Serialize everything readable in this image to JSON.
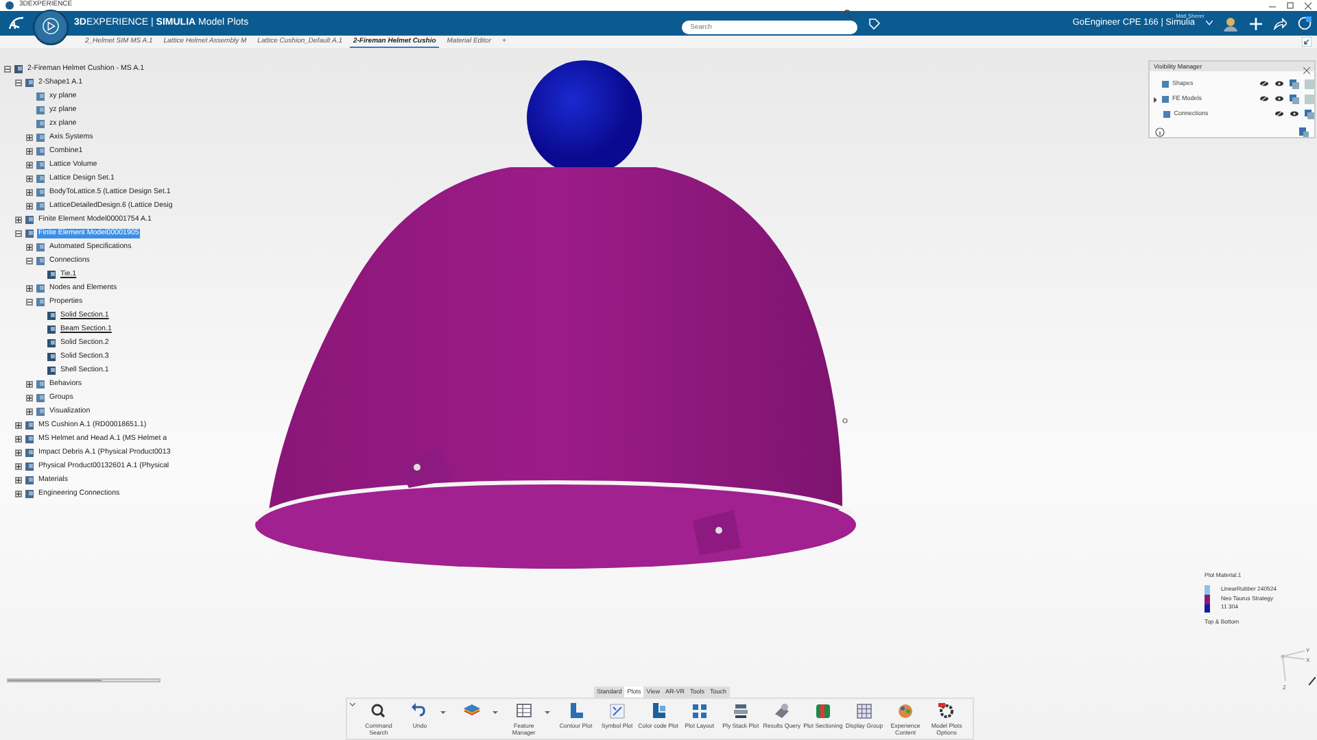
{
  "app_window": {
    "title": "3DEXPERIENCE"
  },
  "header": {
    "title": "**3D**EXPERIENCE | **SIMULIA** Model Plots",
    "search": {
      "placeholder": "Search"
    },
    "user": "Matt Sherer",
    "tenant": "GoEngineer CPE 166 | Simulia"
  },
  "tabs": [
    {
      "label": "2_Helmet SIM MS A.1",
      "selected": false
    },
    {
      "label": "Lattice Helmet Assembly M",
      "selected": false
    },
    {
      "label": "Lattice Cushion_Default A.1",
      "selected": false
    },
    {
      "label": "2-Fireman Helmet Cushio",
      "selected": true
    },
    {
      "label": "Material Editor",
      "selected": false
    },
    {
      "label": "+",
      "selected": false
    }
  ],
  "tree": [
    {
      "label": "2-Fireman Helmet Cushion - MS A.1",
      "expanded": true,
      "selected": false,
      "children": [
        {
          "label": "2-Shape1 A.1",
          "expanded": true,
          "selected": false,
          "children": [
            {
              "label": "xy plane",
              "selected": false
            },
            {
              "label": "yz plane",
              "selected": false
            },
            {
              "label": "zx plane",
              "selected": false
            },
            {
              "label": "Axis Systems",
              "expanded": false,
              "selected": false
            },
            {
              "label": "Combine1",
              "expanded": false,
              "selected": false
            },
            {
              "label": "Lattice Volume",
              "expanded": false,
              "selected": false
            },
            {
              "label": "Lattice Design Set.1",
              "expanded": false,
              "selected": false
            },
            {
              "label": "BodyToLattice.5 (Lattice Design Set.1",
              "expanded": false,
              "selected": false
            },
            {
              "label": "LatticeDetailedDesign.6 (Lattice Desig",
              "expanded": false,
              "selected": false
            }
          ]
        },
        {
          "label": "Finite Element Model00001754 A.1",
          "expanded": false,
          "selected": false
        },
        {
          "label": "Finite Element Model00001905",
          "expanded": true,
          "selected": true,
          "children": [
            {
              "label": "Automated Specifications",
              "expanded": false,
              "selected": false
            },
            {
              "label": "Connections",
              "expanded": true,
              "selected": false,
              "children": [
                {
                  "label": "Tie.1",
                  "selected": false,
                  "underlined": true
                }
              ]
            },
            {
              "label": "Nodes and Elements",
              "expanded": false,
              "selected": false
            },
            {
              "label": "Properties",
              "expanded": true,
              "selected": false,
              "children": [
                {
                  "label": "Solid Section.1",
                  "selected": false,
                  "underlined": true
                },
                {
                  "label": "Beam Section.1",
                  "selected": false,
                  "underlined": true
                },
                {
                  "label": "Solid Section.2",
                  "selected": false,
                  "underlined": false
                },
                {
                  "label": "Solid Section.3",
                  "selected": false,
                  "underlined": false
                },
                {
                  "label": "Shell Section.1",
                  "selected": false,
                  "underlined": false
                }
              ]
            },
            {
              "label": "Behaviors",
              "expanded": false,
              "selected": false
            },
            {
              "label": "Groups",
              "expanded": false,
              "selected": false
            },
            {
              "label": "Visualization",
              "expanded": false,
              "selected": false
            }
          ]
        },
        {
          "label": "MS Cushion A.1 (RD00018651.1)",
          "expanded": false,
          "selected": false
        },
        {
          "label": "MS Helmet and Head A.1 (MS Helmet a",
          "expanded": false,
          "selected": false
        },
        {
          "label": "Impact Debris A.1 (Physical Product0013",
          "expanded": false,
          "selected": false
        },
        {
          "label": "Physical Product00132601 A.1 (Physical",
          "expanded": false,
          "selected": false
        },
        {
          "label": "Materials",
          "expanded": false,
          "selected": false
        },
        {
          "label": "Engineering Connections",
          "expanded": false,
          "selected": false
        }
      ]
    }
  ],
  "visibility_manager": {
    "title": "Visibility Manager",
    "rows": [
      {
        "label": "Shapes",
        "expandable": false,
        "layer_option": true
      },
      {
        "label": "FE Models",
        "expandable": true,
        "layer_option": true
      },
      {
        "label": "Connections",
        "expandable": false,
        "layer_option": false
      }
    ]
  },
  "slider": {
    "level": 0.62
  },
  "legend": {
    "title": "Plot Material.1",
    "entries": [
      "LinearRubber 240524",
      "Neo Taurus Strategy",
      "11 304"
    ],
    "footer": "Top & Bottom"
  },
  "triad": {
    "axes": [
      "Y",
      "X",
      "Z"
    ]
  },
  "toolbar": {
    "tabs": [
      {
        "label": "Standard",
        "selected": false
      },
      {
        "label": "Plots",
        "selected": true
      },
      {
        "label": "View",
        "selected": false
      },
      {
        "label": "AR-VR",
        "selected": false
      },
      {
        "label": "Tools",
        "selected": false
      },
      {
        "label": "Touch",
        "selected": false
      }
    ],
    "buttons": [
      {
        "label": "Command Search",
        "dropdown": false
      },
      {
        "label": "Undo",
        "dropdown": true
      },
      {
        "dropdown": true
      },
      {
        "label": "Feature Manager",
        "dropdown": true
      },
      {
        "label": "Contour Plot",
        "dropdown": false
      },
      {
        "label": "Symbol Plot",
        "dropdown": false
      },
      {
        "label": "Color code Plot",
        "dropdown": false
      },
      {
        "label": "Plot Layout",
        "dropdown": false
      },
      {
        "label": "Ply Stack Plot",
        "dropdown": false
      },
      {
        "label": "Results Query",
        "dropdown": false
      },
      {
        "label": "Plot Sectioning",
        "dropdown": false
      },
      {
        "label": "Display Group",
        "dropdown": false
      },
      {
        "label": "Experience Content",
        "dropdown": false
      },
      {
        "label": "Model Plots Options",
        "dropdown": false
      }
    ]
  }
}
